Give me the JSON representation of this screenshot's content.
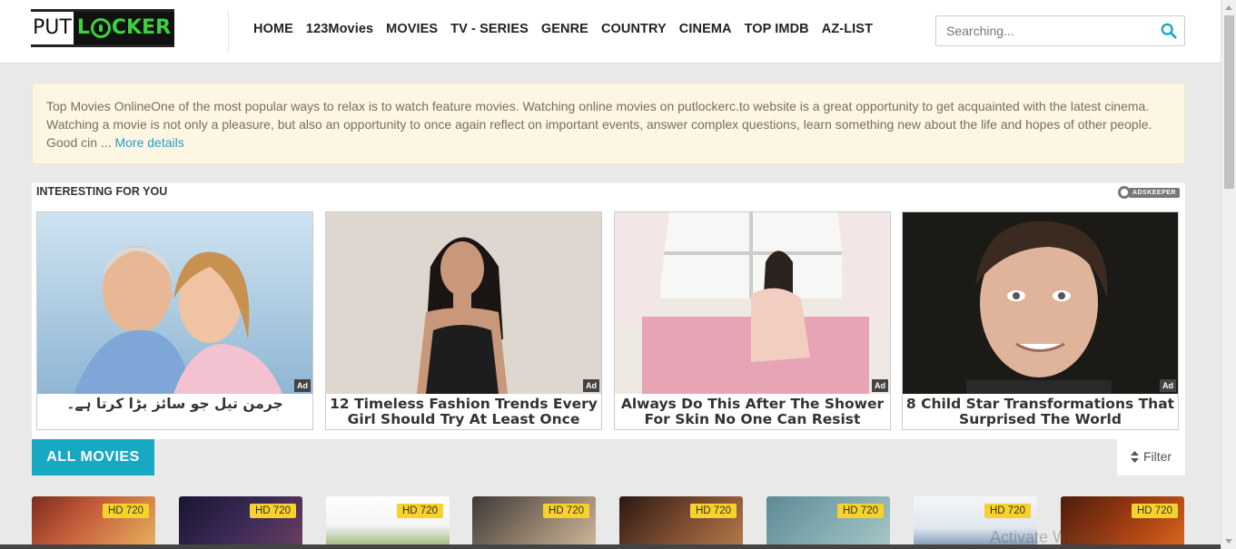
{
  "logo": {
    "put": "PUT",
    "locker_left": "L",
    "locker_right": "CKER"
  },
  "nav": [
    "HOME",
    "123Movies",
    "MOVIES",
    "TV - SERIES",
    "GENRE",
    "COUNTRY",
    "CINEMA",
    "TOP IMDB",
    "AZ-LIST"
  ],
  "search": {
    "placeholder": "Searching..."
  },
  "notice": {
    "text": "Top Movies OnlineOne of the most popular ways to relax is to watch feature movies. Watching online movies on putlockerc.to website is a great opportunity to get acquainted with the latest cinema. Watching a movie is not only a pleasure, but also an opportunity to once again reflect on important events, answer complex questions, learn something new about the life and hopes of other people. Good cin ...",
    "more_label": "More details"
  },
  "ads": {
    "title": "INTERESTING FOR YOU",
    "provider": "ADSKEEPER",
    "badge": "Ad",
    "items": [
      {
        "caption": "جرمن تیل جو سائز بڑا کرتا ہے۔"
      },
      {
        "caption": "12 Timeless Fashion Trends Every Girl Should Try At Least Once"
      },
      {
        "caption": "Always Do This After The Shower For Skin No One Can Resist"
      },
      {
        "caption": "8 Child Star Transformations That Surprised The World"
      }
    ]
  },
  "movies_section": {
    "tab_label": "ALL MOVIES",
    "filter_label": "Filter"
  },
  "movies": [
    {
      "quality": "HD 720"
    },
    {
      "quality": "HD 720"
    },
    {
      "quality": "HD 720"
    },
    {
      "quality": "HD 720"
    },
    {
      "quality": "HD 720"
    },
    {
      "quality": "HD 720"
    },
    {
      "quality": "HD 720"
    },
    {
      "quality": "HD 720"
    }
  ],
  "watermark": "Activate Windows",
  "colors": {
    "accent": "#17a9c3",
    "logo_green": "#3cd23c",
    "quality_badge": "#f7d22c",
    "notice_bg": "#fcf6e3"
  }
}
